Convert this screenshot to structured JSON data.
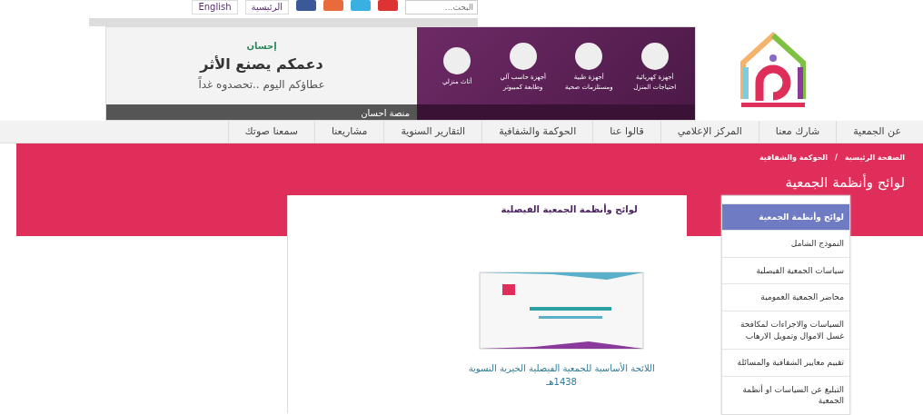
{
  "topbar": {
    "search": {
      "placeholder": "البحث..."
    },
    "links": [
      "الرئيسية",
      "English"
    ]
  },
  "banner": {
    "headline": "دعمكم يصنع الأثر",
    "tagline": "عطاؤكم اليوم ..تحصدوه غداً",
    "partner": "إحسان",
    "caption": "منصة احسان",
    "steps": [
      {
        "label": "أجهزة كهربائية احتياجات المنزل"
      },
      {
        "label": "أجهزة طبية ومستلزمات صحية"
      },
      {
        "label": "أجهزة حاسب آلي وطابعة كمبيوتر"
      },
      {
        "label": "أثاث منزلي"
      }
    ]
  },
  "nav": [
    "عن الجمعية",
    "شارك معنا",
    "المركز الإعلامي",
    "قالوا عنا",
    "الحوكمة والشفافية",
    "التقارير السنوية",
    "مشاريعنا",
    "سمعنا صوتك"
  ],
  "breadcrumb": [
    "الصفحة الرئيسية",
    "الحوكمة والشفافية"
  ],
  "breadcrumb_separator": "/",
  "page_title": "لوائح وأنظمة الجمعية",
  "sidebar": {
    "items": [
      {
        "label": "لوائح وأنظمة الجمعية",
        "selected": true
      },
      {
        "label": "النموذج الشامل",
        "selected": false
      },
      {
        "label": "سياسات الجمعية الفيصلية",
        "selected": false
      },
      {
        "label": "محاضر الجمعية العمومية",
        "selected": false
      },
      {
        "label": "السياسات والاجراءات لمكافحة غسل الاموال وتمويل الارهاب",
        "selected": false
      },
      {
        "label": "تقييم معايير الشفافية والمسائلة",
        "selected": false
      },
      {
        "label": "التبليغ عن السياسات او أنظمة الجمعية",
        "selected": false
      }
    ]
  },
  "main": {
    "heading": "لوائح وأنظمة الجمعية الفيصلية",
    "document": {
      "title": "اللائحة الأساسية للجمعية الفيصلية الخيرية النسوية 1438هـ"
    }
  }
}
